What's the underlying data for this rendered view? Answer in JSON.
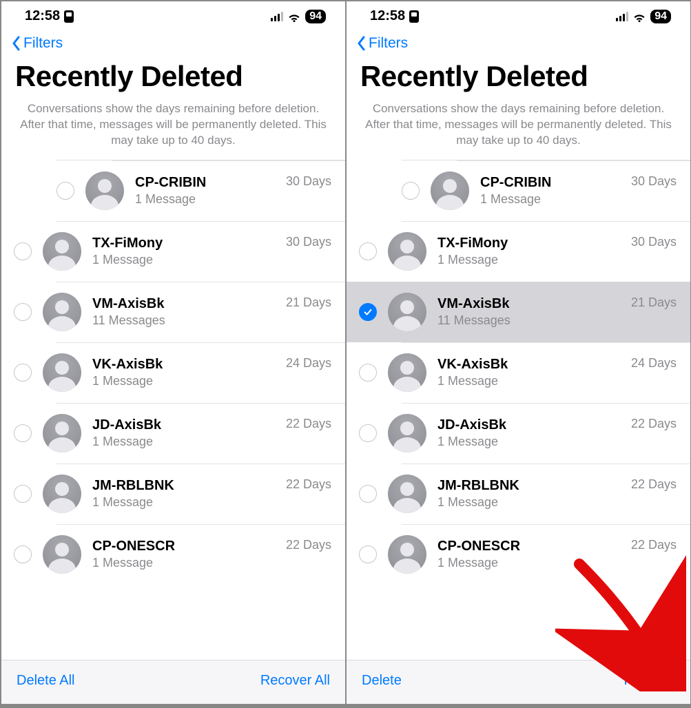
{
  "status": {
    "time": "12:58",
    "battery": "94"
  },
  "nav": {
    "back_label": "Filters"
  },
  "title": "Recently Deleted",
  "subtitle": "Conversations show the days remaining before deletion. After that time, messages will be permanently deleted. This may take up to 40 days.",
  "items": [
    {
      "name": "CP-CRIBIN",
      "sub": "1 Message",
      "days": "30 Days",
      "selected": false
    },
    {
      "name": "TX-FiMony",
      "sub": "1 Message",
      "days": "30 Days",
      "selected": false
    },
    {
      "name": "VM-AxisBk",
      "sub": "11 Messages",
      "days": "21 Days",
      "selected": false
    },
    {
      "name": "VK-AxisBk",
      "sub": "1 Message",
      "days": "24 Days",
      "selected": false
    },
    {
      "name": "JD-AxisBk",
      "sub": "1 Message",
      "days": "22 Days",
      "selected": false
    },
    {
      "name": "JM-RBLBNK",
      "sub": "1 Message",
      "days": "22 Days",
      "selected": false
    },
    {
      "name": "CP-ONESCR",
      "sub": "1 Message",
      "days": "22 Days",
      "selected": false
    }
  ],
  "screens": [
    {
      "selected_index": null,
      "toolbar": {
        "left": "Delete All",
        "right": "Recover All"
      },
      "show_arrow": false
    },
    {
      "selected_index": 2,
      "toolbar": {
        "left": "Delete",
        "right": "Recover"
      },
      "show_arrow": true
    }
  ]
}
